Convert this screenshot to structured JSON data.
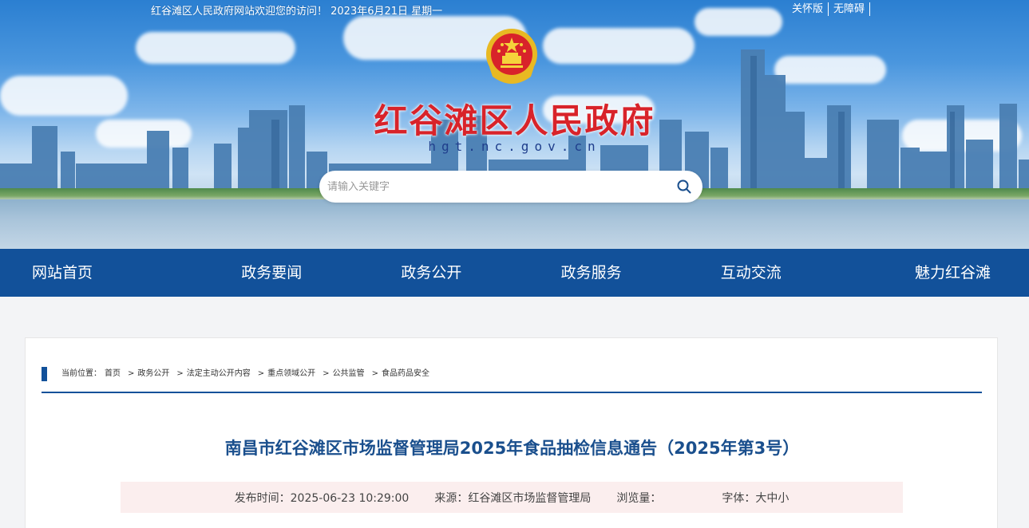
{
  "topbar": {
    "greeting": "红谷滩区人民政府网站欢迎您的访问！ 2023年6月21日 星期一",
    "links": [
      "关怀版",
      "无障碍"
    ]
  },
  "header": {
    "title": "红谷滩区人民政府",
    "domain": "hgt.nc.gov.cn",
    "emblem_icon": "national-emblem-icon"
  },
  "search": {
    "placeholder": "请输入关键字",
    "icon": "search-icon"
  },
  "nav": {
    "items": [
      "网站首页",
      "政务要闻",
      "政务公开",
      "政务服务",
      "互动交流",
      "魅力红谷滩"
    ]
  },
  "breadcrumb": {
    "label": "当前位置：",
    "items": [
      "首页",
      "政务公开",
      "法定主动公开内容",
      "重点领域公开",
      "公共监管",
      "食品药品安全"
    ]
  },
  "article": {
    "title": "南昌市红谷滩区市场监督管理局2025年食品抽检信息通告（2025年第3号）",
    "publish_time": "发布时间：2025-06-23 10:29:00",
    "source": "来源：红谷滩区市场监督管理局",
    "views_label": "浏览量：",
    "font_label": "字体：",
    "font_sizes": [
      "大",
      "中",
      "小"
    ]
  },
  "colors": {
    "nav_bg": "#12519a",
    "title_red": "#d8232a",
    "article_title": "#1a4f8d",
    "meta_bg": "#fbeeee"
  }
}
